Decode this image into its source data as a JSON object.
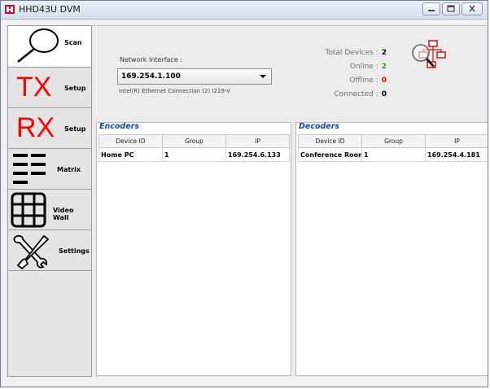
{
  "window": {
    "title": "HHD43U DVM"
  },
  "sidebar": {
    "items": [
      {
        "label": "Scan",
        "icon": "magnifier-icon"
      },
      {
        "label": "Setup",
        "icon_text": "TX"
      },
      {
        "label": "Setup",
        "icon_text": "RX"
      },
      {
        "label": "Matrix",
        "icon": "matrix-lines-icon"
      },
      {
        "label": "Video Wall",
        "icon": "video-wall-grid-icon"
      },
      {
        "label": "Settings",
        "icon": "tools-icon"
      }
    ]
  },
  "network": {
    "label": "Network Interface :",
    "selected": "169.254.1.100",
    "description": "Intel(R) Ethernet Connection (2) I219-V"
  },
  "stats": {
    "total_label": "Total Devices :",
    "total_value": "2",
    "online_label": "Online :",
    "online_value": "2",
    "offline_label": "Offline :",
    "offline_value": "0",
    "connected_label": "Connected :",
    "connected_value": "0"
  },
  "encoders": {
    "title": "Encoders",
    "columns": [
      "Device ID",
      "Group",
      "IP"
    ],
    "rows": [
      [
        "Home PC",
        "1",
        "169.254.6.133"
      ]
    ]
  },
  "decoders": {
    "title": "Decoders",
    "columns": [
      "Device ID",
      "Group",
      "IP"
    ],
    "rows": [
      [
        "Conference Room",
        "1",
        "169.254.4.181"
      ]
    ]
  },
  "colors": {
    "accent_red": "#ff0000",
    "online_green": "#2a9a2a",
    "panel_title_blue": "#1646a6"
  }
}
